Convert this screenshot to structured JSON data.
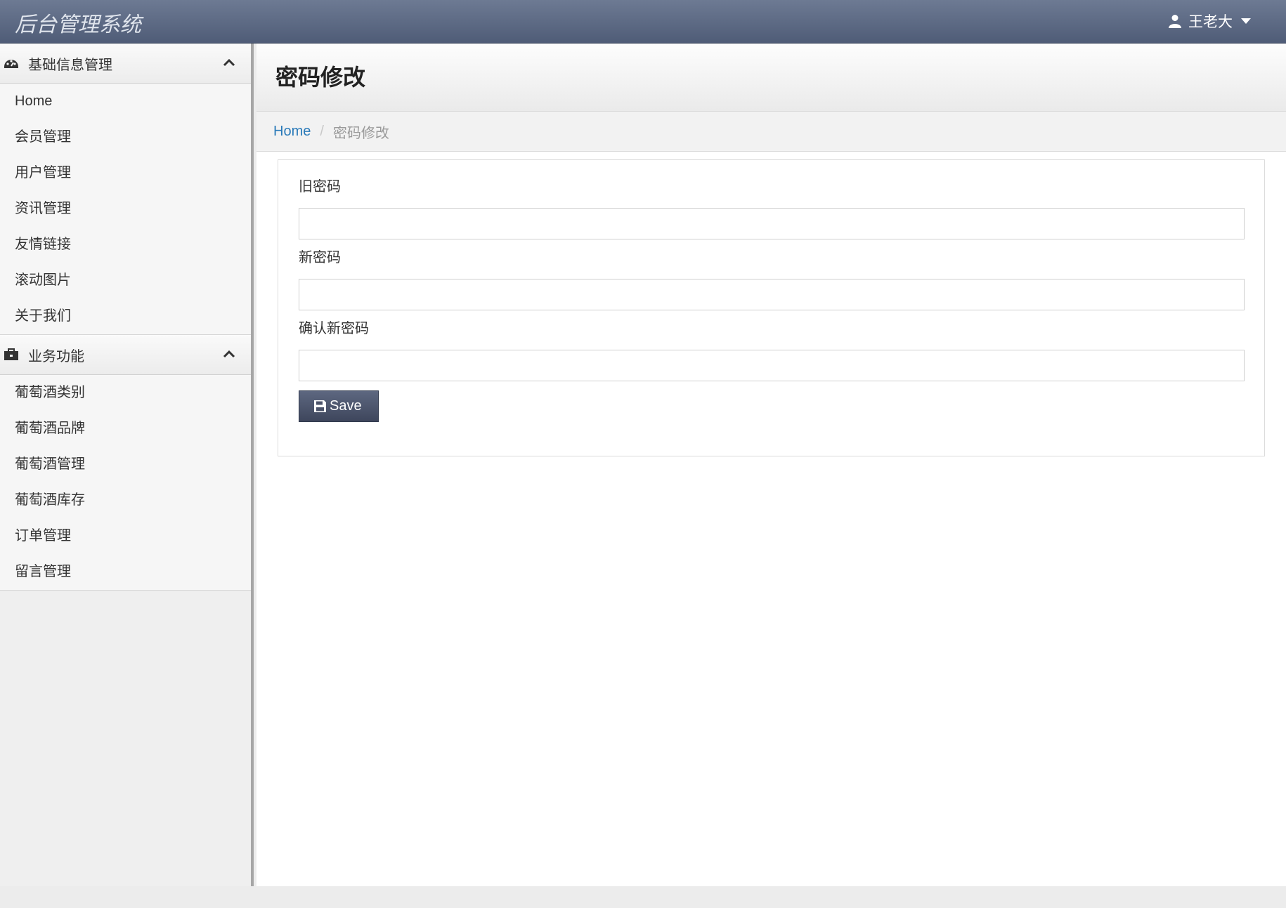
{
  "topbar": {
    "brand": "后台管理系统",
    "user_name": "王老大"
  },
  "sidebar": {
    "groups": [
      {
        "title": "基础信息管理",
        "icon": "dashboard-icon",
        "items": [
          "Home",
          "会员管理",
          "用户管理",
          "资讯管理",
          "友情链接",
          "滚动图片",
          "关于我们"
        ]
      },
      {
        "title": "业务功能",
        "icon": "briefcase-icon",
        "items": [
          "葡萄酒类别",
          "葡萄酒品牌",
          "葡萄酒管理",
          "葡萄酒库存",
          "订单管理",
          "留言管理"
        ]
      }
    ]
  },
  "page": {
    "title": "密码修改",
    "breadcrumb": {
      "home": "Home",
      "current": "密码修改"
    }
  },
  "form": {
    "old_password_label": "旧密码",
    "old_password_value": "",
    "new_password_label": "新密码",
    "new_password_value": "",
    "confirm_password_label": "确认新密码",
    "confirm_password_value": "",
    "save_label": "Save"
  },
  "colors": {
    "topbar": "#5d6a84",
    "link": "#2a7ab9",
    "button": "#4a5269"
  }
}
